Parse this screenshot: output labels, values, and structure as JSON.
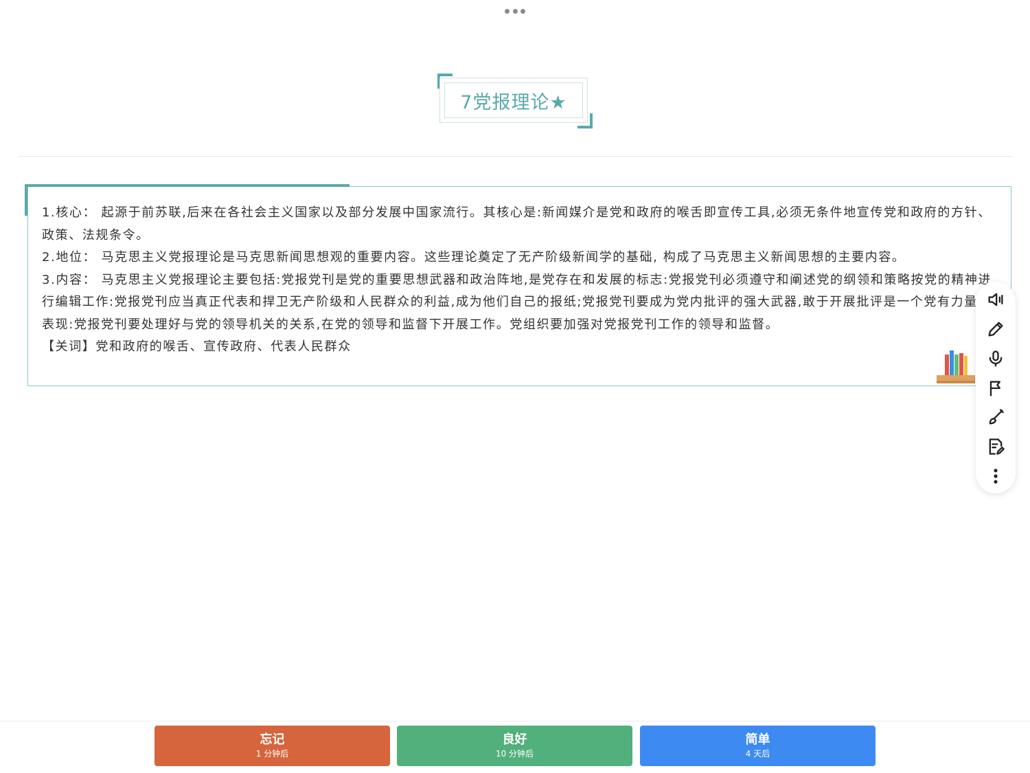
{
  "card": {
    "title": "7党报理论★",
    "lines": [
      "1.核心：  起源于前苏联,后来在各社会主义国家以及部分发展中国家流行。其核心是:新闻媒介是党和政府的喉舌即宣传工具,必须无条件地宣传党和政府的方针、政策、法规条令。",
      "2.地位：  马克思主义党报理论是马克思新闻思想观的重要内容。这些理论奠定了无产阶级新闻学的基础, 构成了马克思主义新闻思想的主要内容。",
      "3.内容：  马克思主义党报理论主要包括:党报党刊是党的重要思想武器和政治阵地,是党存在和发展的标志:党报党刊必须遵守和阐述党的纲领和策略按党的精神进行编辑工作:党报党刊应当真正代表和捍卫无产阶级和人民群众的利益,成为他们自己的报纸;党报党刊要成为党内批评的强大武器,敢于开展批评是一个党有力量的表现:党报党刊要处理好与党的领导机关的关系,在党的领导和监督下开展工作。党组织要加强对党报党刊工作的领导和监督。",
      "【关词】党和政府的喉舌、宣传政府、代表人民群众"
    ]
  },
  "toolbar": {
    "icons": [
      "speaker-icon",
      "pencil-icon",
      "microphone-icon",
      "flag-icon",
      "brush-icon",
      "edit-note-icon",
      "more-icon"
    ]
  },
  "answer_buttons": {
    "again": {
      "label": "忘记",
      "interval": "1 分钟后",
      "color": "#d6643c"
    },
    "good": {
      "label": "良好",
      "interval": "10 分钟后",
      "color": "#52b07c"
    },
    "easy": {
      "label": "简单",
      "interval": "4 天后",
      "color": "#3d8af3"
    }
  },
  "colors": {
    "accent": "#5aa9a9"
  }
}
